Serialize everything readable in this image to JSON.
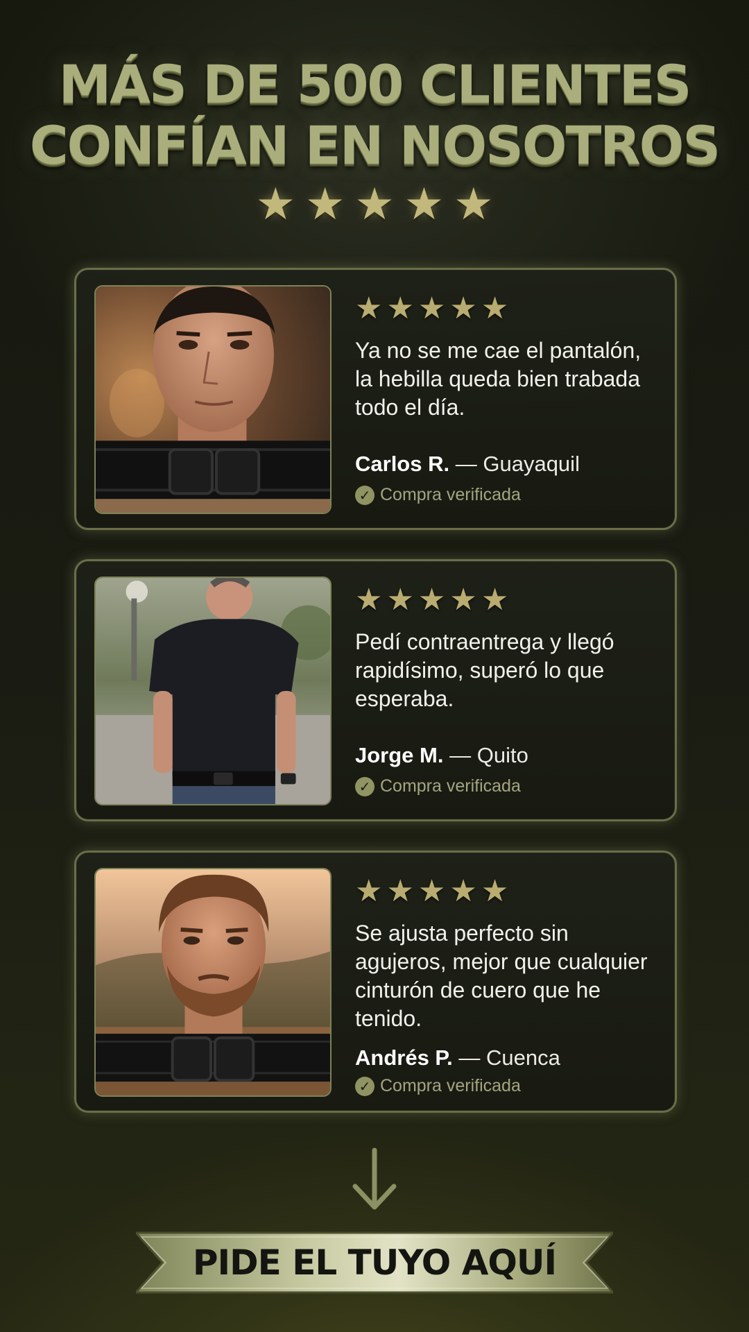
{
  "header": {
    "title_line1": "MÁS DE 500 CLIENTES",
    "title_line2": "CONFÍAN EN NOSOTROS",
    "rating_stars": 5
  },
  "reviews": [
    {
      "rating": 5,
      "quote": "Ya no se me cae el pantalón, la hebilla queda bien trabada todo el día.",
      "name": "Carlos R.",
      "separator": "—",
      "city": "Guayaquil",
      "verified_label": "Compra verificada",
      "photo_icon": "customer-portrait-belt"
    },
    {
      "rating": 5,
      "quote": "Pedí contraentrega y llegó rapidísimo, superó lo que esperaba.",
      "name": "Jorge M.",
      "separator": "—",
      "city": "Quito",
      "verified_label": "Compra verificada",
      "photo_icon": "customer-tshirt-belt"
    },
    {
      "rating": 5,
      "quote": "Se ajusta perfecto sin agujeros, mejor que cualquier cinturón de cuero que he tenido.",
      "name": "Andrés P.",
      "separator": "—",
      "city": "Cuenca",
      "verified_label": "Compra verificada",
      "photo_icon": "customer-portrait-belt"
    }
  ],
  "cta": {
    "label": "PIDE EL TUYO AQUÍ",
    "arrow_icon": "arrow-down-icon"
  },
  "colors": {
    "accent": "#a9ae7c",
    "star": "#c2b87b",
    "card_border": "#6a6e49",
    "background": "#1a1c13"
  }
}
